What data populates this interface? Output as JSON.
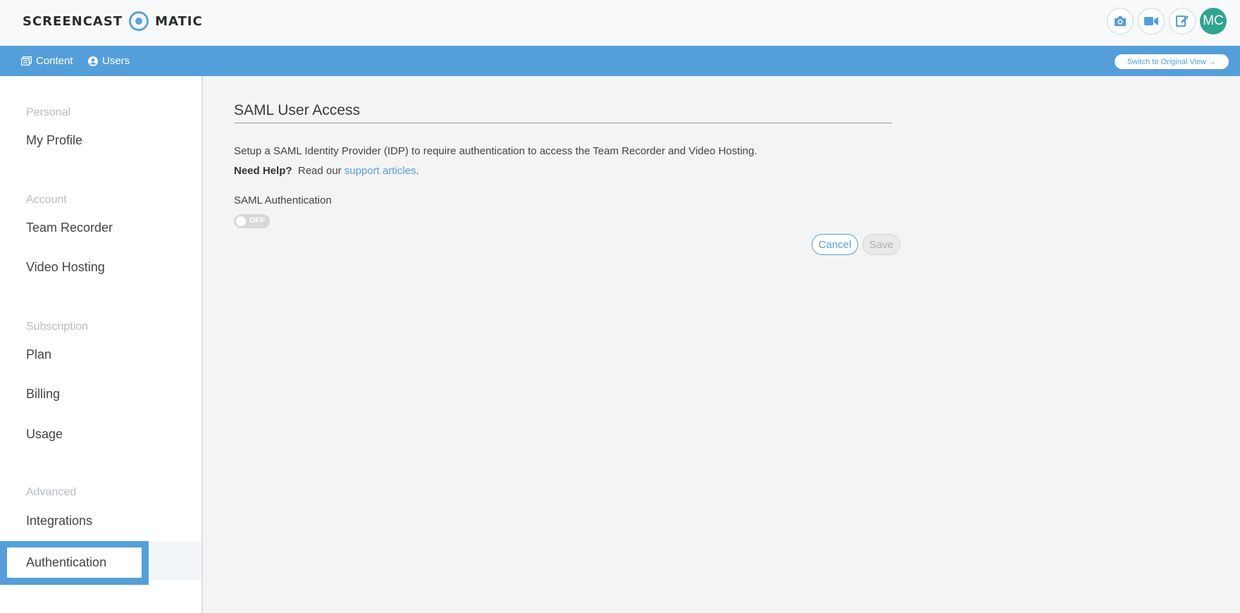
{
  "header": {
    "logo_left": "SCREENCAST",
    "logo_right": "MATIC",
    "tools": {
      "screenshot_icon": "camera-icon",
      "record_icon": "video-camera-icon",
      "edit_icon": "edit-icon"
    },
    "avatar_initials": "MC",
    "avatar_color": "#2fa58f"
  },
  "nav": {
    "content_label": "Content",
    "users_label": "Users",
    "switch_label": "Switch to Original View →",
    "bar_color": "#549fd9"
  },
  "sidebar": {
    "sections": [
      {
        "title": "Personal",
        "items": [
          "My Profile"
        ]
      },
      {
        "title": "Account",
        "items": [
          "Team Recorder",
          "Video Hosting"
        ]
      },
      {
        "title": "Subscription",
        "items": [
          "Plan",
          "Billing",
          "Usage"
        ]
      },
      {
        "title": "Advanced",
        "items": [
          "Integrations",
          "Authentication"
        ]
      }
    ],
    "active_item": "Authentication"
  },
  "main": {
    "title": "SAML User Access",
    "description": "Setup a SAML Identity Provider (IDP) to require authentication to access the Team Recorder and Video Hosting.",
    "help_bold": "Need Help?",
    "help_text": "Read our",
    "help_link": "support articles",
    "help_end": ".",
    "saml_label": "SAML Authentication",
    "toggle_state": "OFF",
    "cancel_label": "Cancel",
    "save_label": "Save"
  }
}
